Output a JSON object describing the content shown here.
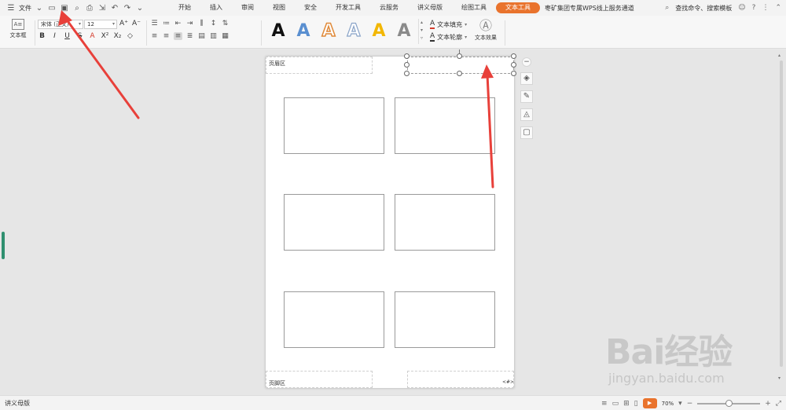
{
  "menu": {
    "file_label": "文件",
    "tabs": [
      "开始",
      "插入",
      "审阅",
      "视图",
      "安全",
      "开发工具",
      "云服务",
      "讲义母版",
      "绘图工具",
      "文本工具"
    ],
    "active_tab": "文本工具",
    "promo": "枣矿集团专属WPS线上服务通道",
    "search_label": "查找命令、搜索模板"
  },
  "ribbon": {
    "textbox_label": "文本框",
    "font_name": "宋体 (正文)",
    "font_size": "12",
    "text_fill_label": "文本填充",
    "text_outline_label": "文本轮廓",
    "text_effects_label": "文本效果"
  },
  "page": {
    "header_label": "页眉区",
    "footer_label": "页脚区",
    "page_number": "<#>",
    "slide_count": 6
  },
  "statusbar": {
    "mode_label": "讲义母版",
    "zoom": "70%"
  },
  "watermark": {
    "brand": "Bai经验",
    "url": "jingyan.baidu.com"
  },
  "colors": {
    "accent": "#e9732d",
    "arrow": "#e8403a"
  }
}
